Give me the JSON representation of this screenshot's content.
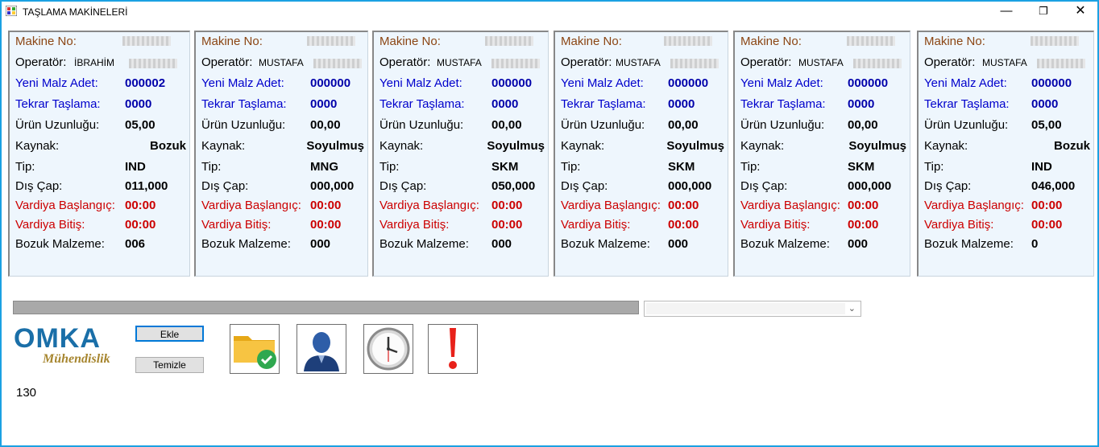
{
  "window": {
    "title": "TAŞLAMA MAKİNELERİ",
    "min": "—",
    "max": "❐",
    "close": "✕"
  },
  "labels": {
    "machine_no": "Makine No:",
    "operator": "Operatör:",
    "new_qty": "Yeni Malz Adet:",
    "regrind": "Tekrar Taşlama:",
    "length": "Ürün Uzunluğu:",
    "source": "Kaynak:",
    "type": "Tip:",
    "outer_dia": "Dış Çap:",
    "shift_start": "Vardiya Başlangıç:",
    "shift_end": "Vardiya Bitiş:",
    "defect": "Bozuk Malzeme:"
  },
  "machines": [
    {
      "operator": "İBRAHİM",
      "new_qty": "000002",
      "regrind": "0000",
      "length": "05,00",
      "source": "Bozuk",
      "type": "IND",
      "outer_dia": "011,000",
      "shift_start": "00:00",
      "shift_end": "00:00",
      "defect": "006"
    },
    {
      "operator": "MUSTAFA",
      "new_qty": "000000",
      "regrind": "0000",
      "length": "00,00",
      "source": "Soyulmuş",
      "type": "MNG",
      "outer_dia": "000,000",
      "shift_start": "00:00",
      "shift_end": "00:00",
      "defect": "000"
    },
    {
      "operator": "MUSTAFA",
      "new_qty": "000000",
      "regrind": "0000",
      "length": "00,00",
      "source": "Soyulmuş",
      "type": "SKM",
      "outer_dia": "050,000",
      "shift_start": "00:00",
      "shift_end": "00:00",
      "defect": "000"
    },
    {
      "operator": "MUSTAFA",
      "new_qty": "000000",
      "regrind": "0000",
      "length": "00,00",
      "source": "Soyulmuş",
      "type": "SKM",
      "outer_dia": "000,000",
      "shift_start": "00:00",
      "shift_end": "00:00",
      "defect": "000"
    },
    {
      "operator": "MUSTAFA",
      "new_qty": "000000",
      "regrind": "0000",
      "length": "00,00",
      "source": "Soyulmuş",
      "type": "SKM",
      "outer_dia": "000,000",
      "shift_start": "00:00",
      "shift_end": "00:00",
      "defect": "000"
    },
    {
      "operator": "MUSTAFA",
      "new_qty": "000000",
      "regrind": "0000",
      "length": "05,00",
      "source": "Bozuk",
      "type": "IND",
      "outer_dia": "046,000",
      "shift_start": "00:00",
      "shift_end": "00:00",
      "defect": "0"
    }
  ],
  "logo": {
    "main": "OMKA",
    "sub": "Mühendislik"
  },
  "buttons": {
    "add": "Ekle",
    "clear": "Temizle"
  },
  "icons": [
    "folder-check-icon",
    "user-icon",
    "clock-icon",
    "alert-icon"
  ],
  "counter": "130",
  "progress": 1.0,
  "colors": {
    "label_brown": "#8b4513",
    "label_blue": "#0000cc",
    "label_red": "#cc0000",
    "panel_bg": "#eef6fd",
    "window_border": "#1ba1e2"
  }
}
